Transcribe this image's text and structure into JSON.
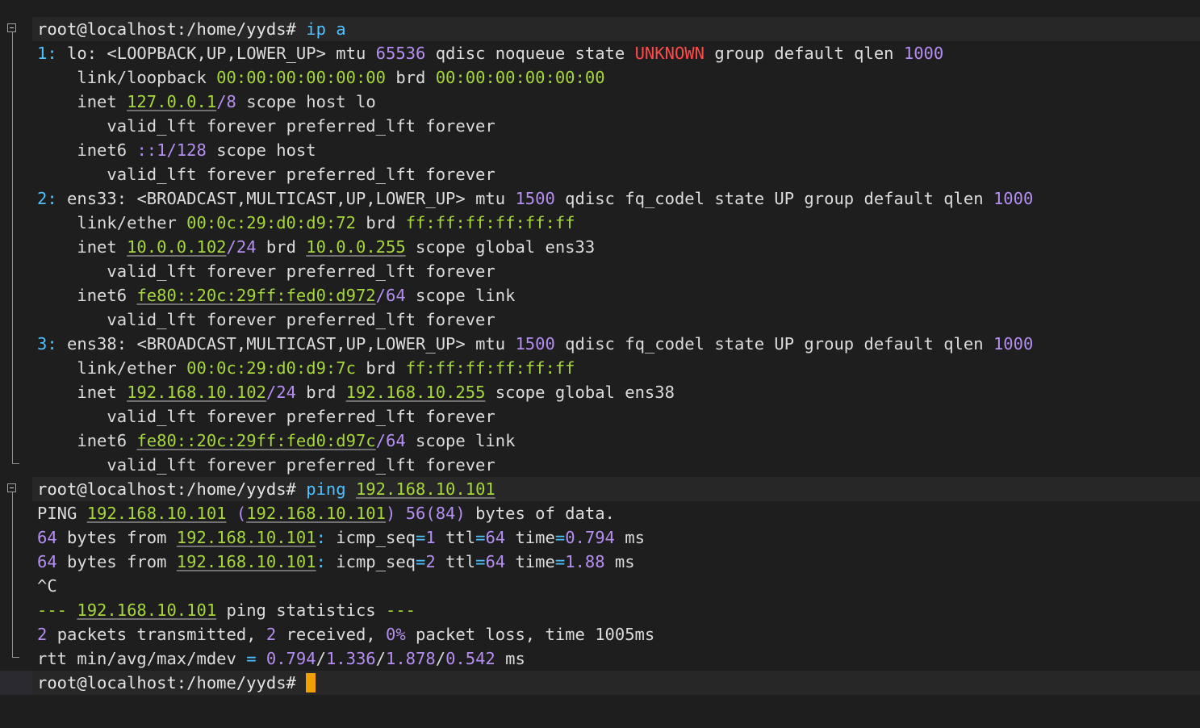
{
  "terminal": {
    "prompt": "root@localhost:/home/yyds#",
    "cmd1": "ip a",
    "cmd2_name": "ping",
    "cmd2_arg": "192.168.10.101",
    "colors": {
      "background": "#1e1e1e",
      "text": "#dcdcdc",
      "command": "#4fc1ff",
      "number": "#b48ef0",
      "address": "#a6d73a",
      "state_unknown": "#ff4a4a",
      "cursor": "#f0a000"
    }
  },
  "ip": {
    "lo": {
      "idx": "1:",
      "name": "lo:",
      "flags": "<LOOPBACK,UP,LOWER_UP>",
      "mtu_label": "mtu",
      "mtu": "65536",
      "qdisc_label": "qdisc",
      "qdisc": "noqueue",
      "state_label": "state",
      "state": "UNKNOWN",
      "group_label": "group default qlen",
      "qlen": "1000",
      "link_label": "link/loopback",
      "mac": "00:00:00:00:00:00",
      "brd_label": "brd",
      "brd": "00:00:00:00:00:00",
      "inet_label": "inet",
      "inet_addr": "127.0.0.1",
      "inet_prefix": "/8",
      "inet_scope": "scope host lo",
      "valid1": "valid_lft forever preferred_lft forever",
      "inet6_label": "inet6",
      "inet6_addr": "::1",
      "inet6_prefix": "/128",
      "inet6_scope": "scope host",
      "valid2": "valid_lft forever preferred_lft forever"
    },
    "ens33": {
      "idx": "2:",
      "name": "ens33:",
      "flags": "<BROADCAST,MULTICAST,UP,LOWER_UP>",
      "mtu_label": "mtu",
      "mtu": "1500",
      "qdisc_label": "qdisc",
      "qdisc": "fq_codel",
      "state_label": "state",
      "state": "UP",
      "group_label": "group default qlen",
      "qlen": "1000",
      "link_label": "link/ether",
      "mac": "00:0c:29:d0:d9:72",
      "brd_label": "brd",
      "brd": "ff:ff:ff:ff:ff:ff",
      "inet_label": "inet",
      "inet_addr": "10.0.0.102",
      "inet_prefix": "/24",
      "inet_brd_label": "brd",
      "inet_brd": "10.0.0.255",
      "inet_scope": "scope global ens33",
      "valid1": "valid_lft forever preferred_lft forever",
      "inet6_label": "inet6",
      "inet6_addr": "fe80::20c:29ff:fed0:d972",
      "inet6_prefix": "/64",
      "inet6_scope": "scope link",
      "valid2": "valid_lft forever preferred_lft forever"
    },
    "ens38": {
      "idx": "3:",
      "name": "ens38:",
      "flags": "<BROADCAST,MULTICAST,UP,LOWER_UP>",
      "mtu_label": "mtu",
      "mtu": "1500",
      "qdisc_label": "qdisc",
      "qdisc": "fq_codel",
      "state_label": "state",
      "state": "UP",
      "group_label": "group default qlen",
      "qlen": "1000",
      "link_label": "link/ether",
      "mac": "00:0c:29:d0:d9:7c",
      "brd_label": "brd",
      "brd": "ff:ff:ff:ff:ff:ff",
      "inet_label": "inet",
      "inet_addr": "192.168.10.102",
      "inet_prefix": "/24",
      "inet_brd_label": "brd",
      "inet_brd": "192.168.10.255",
      "inet_scope": "scope global ens38",
      "valid1": "valid_lft forever preferred_lft forever",
      "inet6_label": "inet6",
      "inet6_addr": "fe80::20c:29ff:fed0:d97c",
      "inet6_prefix": "/64",
      "inet6_scope": "scope link",
      "valid2": "valid_lft forever preferred_lft forever"
    }
  },
  "ping": {
    "header_label": "PING",
    "header_host": "192.168.10.101",
    "header_paren_open": "(",
    "header_ip": "192.168.10.101",
    "header_paren_close": ")",
    "header_size": "56(84)",
    "header_tail": "bytes of data.",
    "replies": [
      {
        "bytes": "64",
        "from_label": "bytes from",
        "ip": "192.168.10.101",
        "colon": ":",
        "seq_label": "icmp_seq",
        "eq": "=",
        "seq": "1",
        "ttl_label": "ttl",
        "ttl": "64",
        "time_label": "time",
        "time": "0.794",
        "unit": "ms"
      },
      {
        "bytes": "64",
        "from_label": "bytes from",
        "ip": "192.168.10.101",
        "colon": ":",
        "seq_label": "icmp_seq",
        "eq": "=",
        "seq": "2",
        "ttl_label": "ttl",
        "ttl": "64",
        "time_label": "time",
        "time": "1.88",
        "unit": "ms"
      }
    ],
    "interrupt": "^C",
    "stats_dashes_open": "---",
    "stats_host": "192.168.10.101",
    "stats_title": "ping statistics",
    "stats_dashes_close": "---",
    "tx": "2",
    "tx_label": "packets transmitted,",
    "rx": "2",
    "rx_label": "received,",
    "loss": "0%",
    "loss_label": "packet loss, time 1005ms",
    "rtt_label": "rtt min/avg/max/mdev",
    "rtt_eq": "=",
    "rtt_min": "0.794",
    "rtt_avg": "1.336",
    "rtt_max": "1.878",
    "rtt_mdev": "0.542",
    "slash": "/",
    "rtt_unit": "ms"
  }
}
